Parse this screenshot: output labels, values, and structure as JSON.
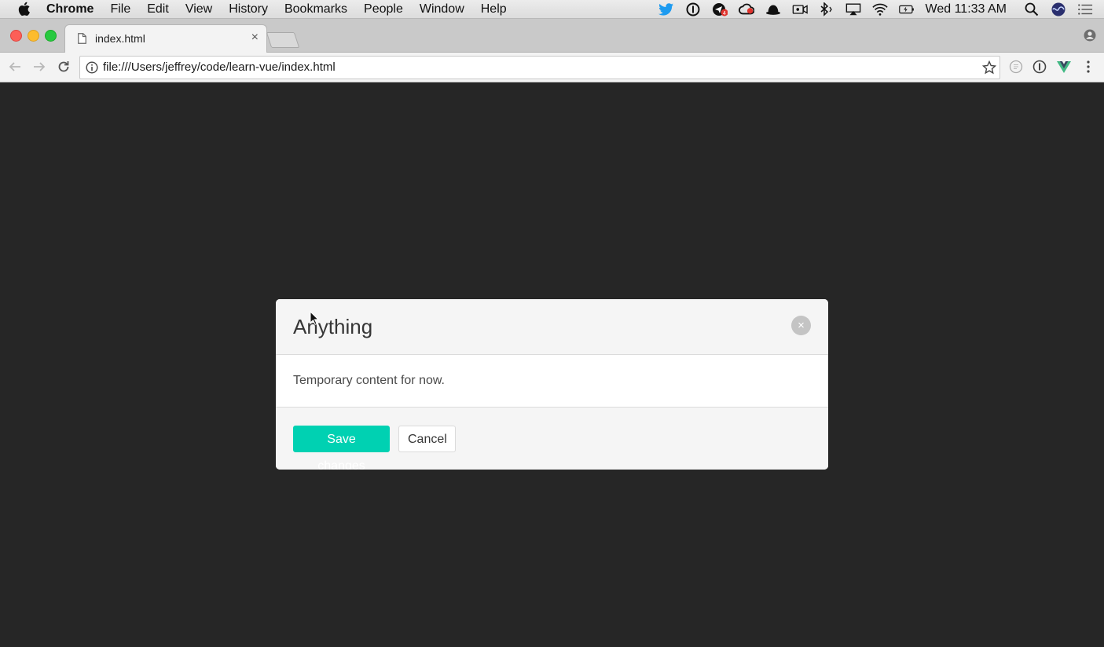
{
  "menubar": {
    "app_name": "Chrome",
    "items": [
      "File",
      "Edit",
      "View",
      "History",
      "Bookmarks",
      "People",
      "Window",
      "Help"
    ],
    "clock": "Wed 11:33 AM",
    "status_icons": [
      "twitter-icon",
      "1password-icon",
      "notification-badge-icon",
      "creative-cloud-icon",
      "alfred-hat-icon",
      "screen-record-icon",
      "bluetooth-icon",
      "airplay-icon",
      "wifi-icon",
      "battery-charging-icon",
      "spotlight-search-icon",
      "siri-icon",
      "notification-center-icon"
    ],
    "badge_count": "4"
  },
  "tab": {
    "title": "index.html",
    "close": "×"
  },
  "toolbar": {
    "url": "file:///Users/jeffrey/code/learn-vue/index.html"
  },
  "modal": {
    "title": "Anything",
    "close": "×",
    "body": "Temporary content for now.",
    "save_label": "Save changes",
    "cancel_label": "Cancel"
  },
  "colors": {
    "page_background": "#262626",
    "primary_button": "#00d1b2",
    "modal_header": "#f5f5f5"
  }
}
